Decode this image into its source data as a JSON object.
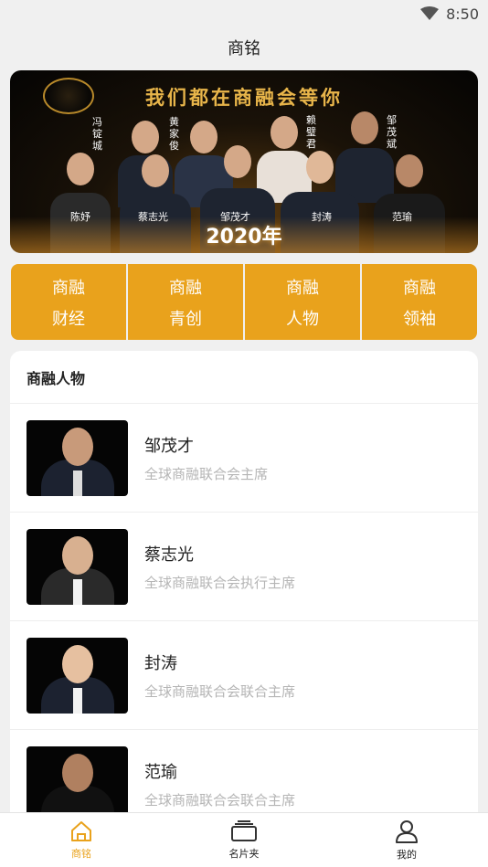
{
  "status_bar": {
    "time": "8:50",
    "wifi_icon": "wifi-icon"
  },
  "header": {
    "title": "商铭"
  },
  "banner": {
    "slogan": "我们都在商融会等你",
    "year": "2020年",
    "names_top": [
      "冯锭城",
      "黄家俊",
      "赖璧君",
      "邹茂斌"
    ],
    "names_bottom": [
      "陈妤",
      "蔡志光",
      "邹茂才",
      "封涛",
      "范瑜"
    ]
  },
  "categories": [
    {
      "line1": "商融",
      "line2": "财经"
    },
    {
      "line1": "商融",
      "line2": "青创"
    },
    {
      "line1": "商融",
      "line2": "人物"
    },
    {
      "line1": "商融",
      "line2": "领袖"
    }
  ],
  "section": {
    "title": "商融人物"
  },
  "people": [
    {
      "name": "邹茂才",
      "title": "全球商融联合会主席"
    },
    {
      "name": "蔡志光",
      "title": "全球商融联合会执行主席"
    },
    {
      "name": "封涛",
      "title": "全球商融联合会联合主席"
    },
    {
      "name": "范瑜",
      "title": "全球商融联合会联合主席"
    }
  ],
  "tabbar": [
    {
      "label": "商铭",
      "icon": "home-icon",
      "active": true
    },
    {
      "label": "名片夹",
      "icon": "card-holder-icon",
      "active": false
    },
    {
      "label": "我的",
      "icon": "user-icon",
      "active": false
    }
  ],
  "colors": {
    "accent": "#e9a21c",
    "muted_text": "#b5b5b5"
  }
}
